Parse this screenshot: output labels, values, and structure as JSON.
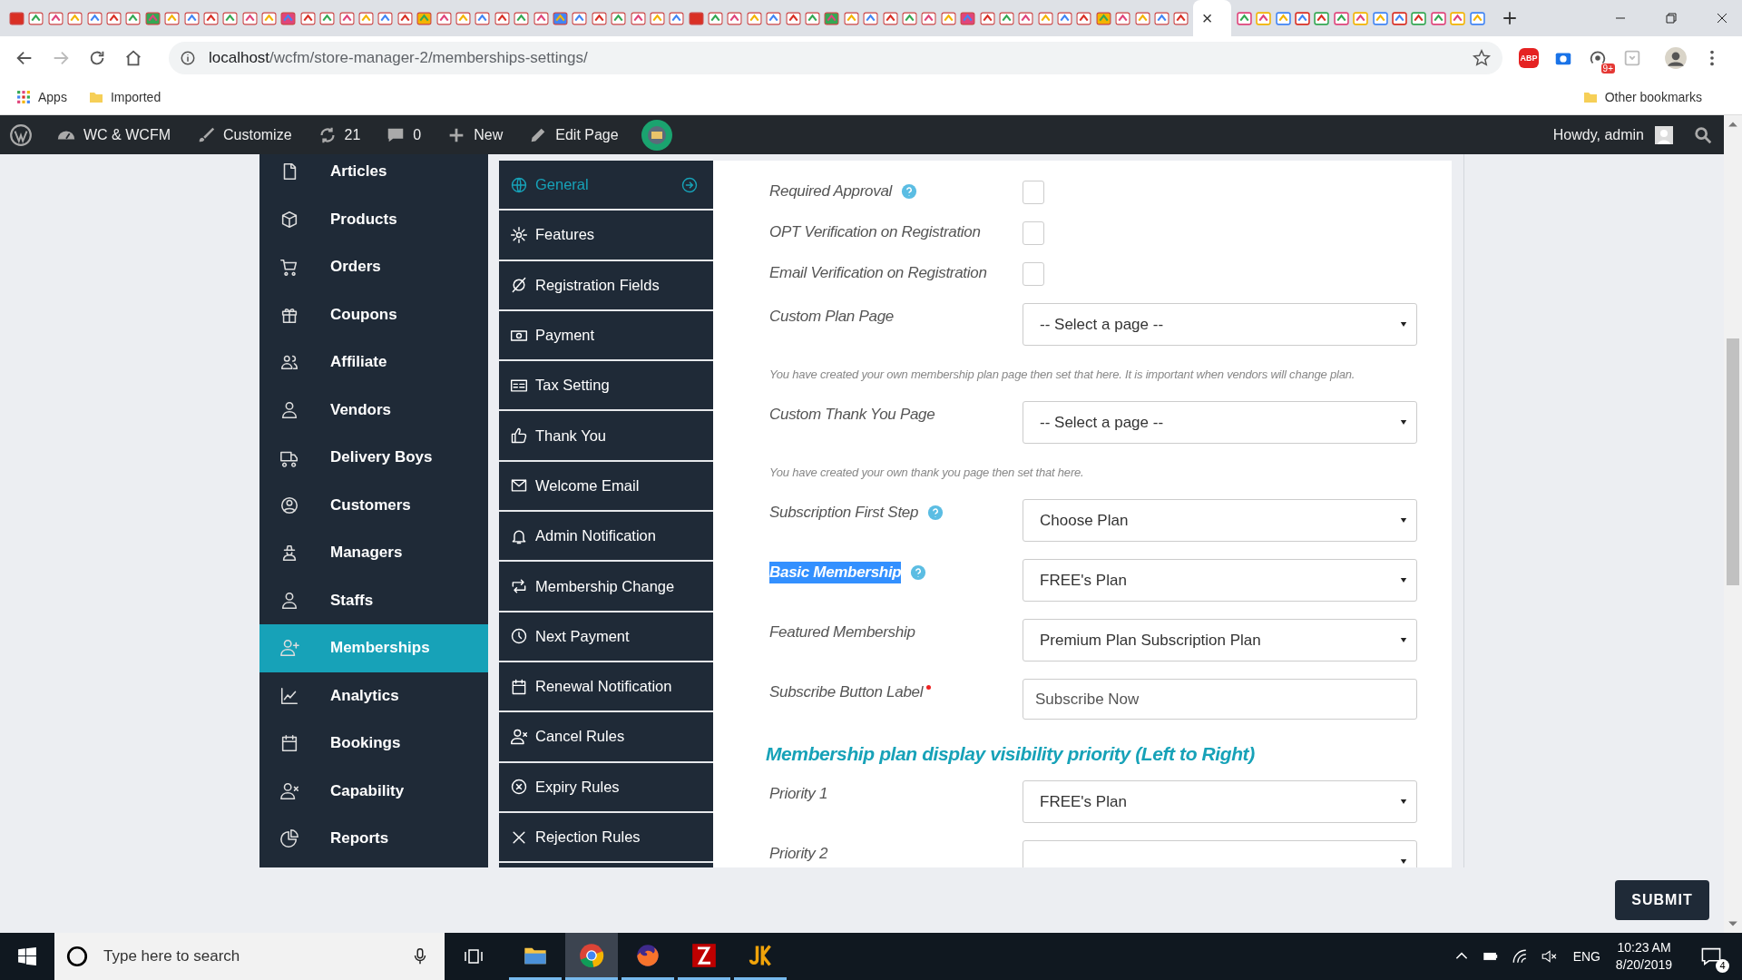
{
  "browser": {
    "active_tab_close": "×",
    "url_host": "localhost",
    "url_path": "/wcfm/store-manager-2/memberships-settings/",
    "adblock_label": "ABP",
    "extension_badge": "9+",
    "bookmarks": [
      "Apps",
      "Imported"
    ],
    "other_bookmarks": "Other bookmarks"
  },
  "admin_bar": {
    "site": "WC & WCFM",
    "customize": "Customize",
    "updates": "21",
    "comments": "0",
    "new": "New",
    "edit": "Edit Page",
    "greeting": "Howdy, admin"
  },
  "menu": [
    {
      "label": "Articles",
      "selected": false
    },
    {
      "label": "Products",
      "selected": false
    },
    {
      "label": "Orders",
      "selected": false
    },
    {
      "label": "Coupons",
      "selected": false
    },
    {
      "label": "Affiliate",
      "selected": false
    },
    {
      "label": "Vendors",
      "selected": false
    },
    {
      "label": "Delivery Boys",
      "selected": false
    },
    {
      "label": "Customers",
      "selected": false
    },
    {
      "label": "Managers",
      "selected": false
    },
    {
      "label": "Staffs",
      "selected": false
    },
    {
      "label": "Memberships",
      "selected": true
    },
    {
      "label": "Analytics",
      "selected": false
    },
    {
      "label": "Bookings",
      "selected": false
    },
    {
      "label": "Capability",
      "selected": false
    },
    {
      "label": "Reports",
      "selected": false
    }
  ],
  "submenu": [
    {
      "label": "General",
      "selected": true
    },
    {
      "label": "Features",
      "selected": false
    },
    {
      "label": "Registration Fields",
      "selected": false
    },
    {
      "label": "Payment",
      "selected": false
    },
    {
      "label": "Tax Setting",
      "selected": false
    },
    {
      "label": "Thank You",
      "selected": false
    },
    {
      "label": "Welcome Email",
      "selected": false
    },
    {
      "label": "Admin Notification",
      "selected": false
    },
    {
      "label": "Membership Change",
      "selected": false
    },
    {
      "label": "Next Payment",
      "selected": false
    },
    {
      "label": "Renewal Notification",
      "selected": false
    },
    {
      "label": "Cancel Rules",
      "selected": false
    },
    {
      "label": "Expiry Rules",
      "selected": false
    },
    {
      "label": "Rejection Rules",
      "selected": false
    }
  ],
  "form": {
    "rows": [
      {
        "kind": "checkbox",
        "label": "Required Approval",
        "help": true,
        "checked": false
      },
      {
        "kind": "checkbox",
        "label": "OPT Verification on Registration",
        "checked": false
      },
      {
        "kind": "checkbox",
        "label": "Email Verification on Registration",
        "checked": false
      },
      {
        "kind": "select",
        "label": "Custom Plan Page",
        "value": "-- Select a page --",
        "note": "You have created your own membership plan page then set that here. It is important when vendors will change plan."
      },
      {
        "kind": "select",
        "label": "Custom Thank You Page",
        "value": "-- Select a page --",
        "note": "You have created your own thank you page then set that here."
      },
      {
        "kind": "select",
        "label": "Subscription First Step",
        "help": true,
        "value": "Choose Plan"
      },
      {
        "kind": "select",
        "label": "Basic Membership",
        "help": true,
        "highlighted": true,
        "value": "FREE's Plan"
      },
      {
        "kind": "select",
        "label": "Featured Membership",
        "value": "Premium Plan Subscription Plan"
      },
      {
        "kind": "text",
        "label": "Subscribe Button Label",
        "required": true,
        "value": "Subscribe Now"
      },
      {
        "kind": "heading",
        "label": "Membership plan display visibility priority (Left to Right)"
      },
      {
        "kind": "select",
        "label": "Priority 1",
        "value": "FREE's Plan"
      },
      {
        "kind": "select",
        "label": "Priority 2"
      }
    ]
  },
  "submit": "SUBMIT",
  "taskbar": {
    "search_placeholder": "Type here to search",
    "language": "ENG",
    "time": "10:23 AM",
    "date": "8/20/2019",
    "notifications": "4"
  }
}
